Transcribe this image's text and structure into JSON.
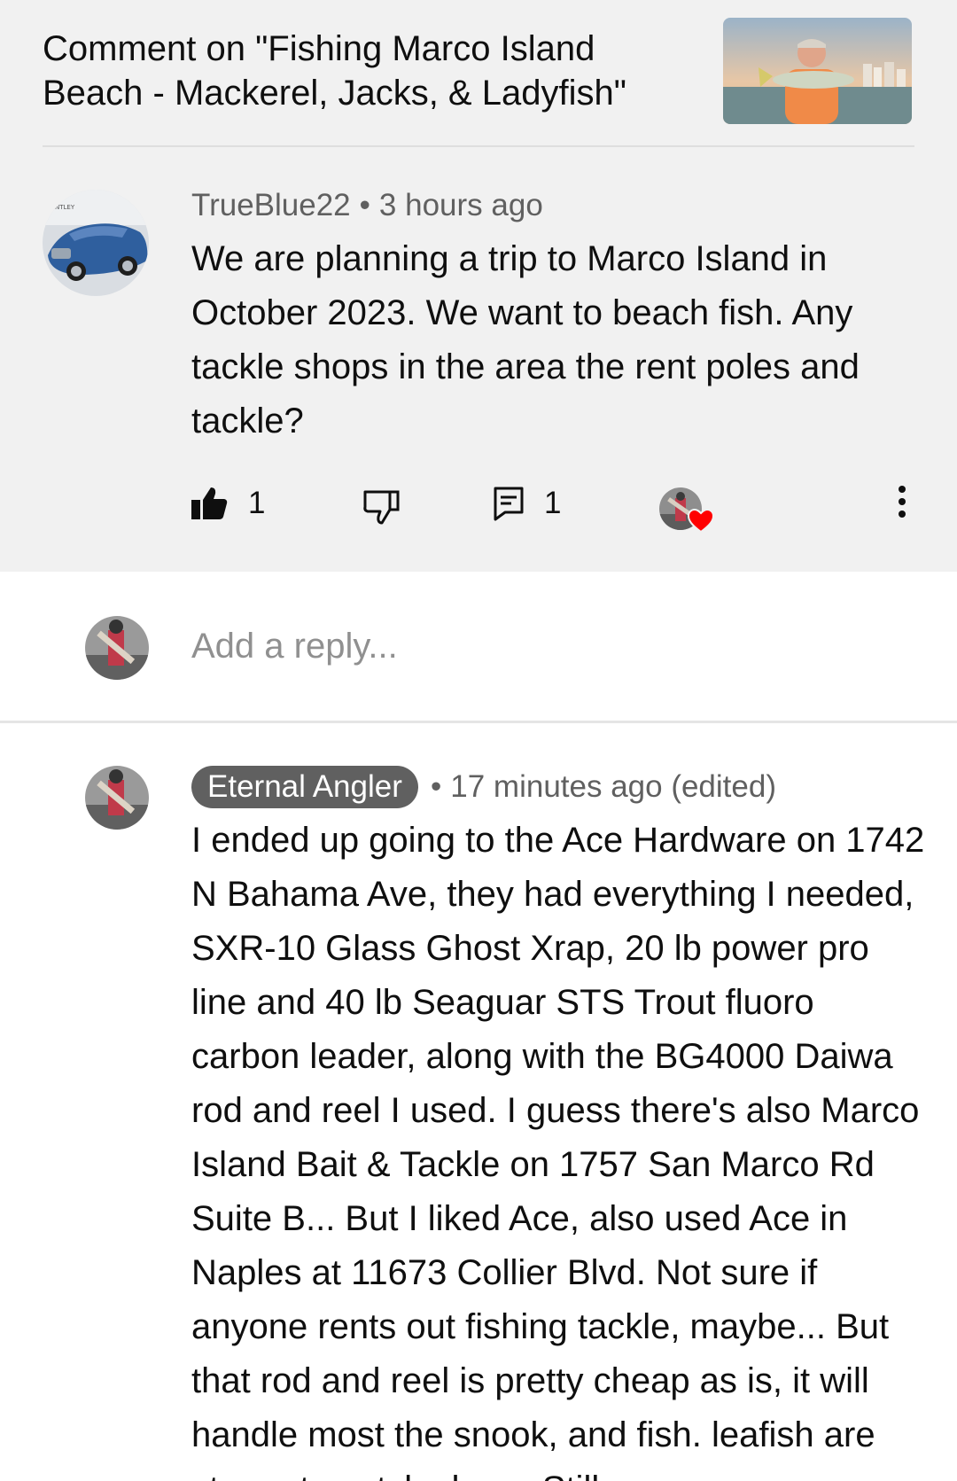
{
  "header": {
    "title": "Comment on \"Fishing Marco Island Beach - Mackerel, Jacks, & Ladyfish\""
  },
  "comment": {
    "author": "TrueBlue22",
    "separator": "•",
    "time": "3 hours ago",
    "text": "We are planning a trip to Marco Island in October 2023.  We want to beach fish.  Any tackle shops in the area the rent poles and tackle?",
    "like_count": "1",
    "reply_count": "1"
  },
  "reply_box": {
    "placeholder": "Add a reply..."
  },
  "reply": {
    "author": "Eternal Angler",
    "separator": "•",
    "time": "17 minutes ago (edited)",
    "text": "I ended up going to the Ace Hardware on 1742 N Bahama Ave, they had everything I needed, SXR-10 Glass Ghost Xrap, 20 lb power pro line and 40 lb Seaguar STS Trout fluoro carbon leader, along with the BG4000 Daiwa rod and reel I used. I guess there's also Marco Island Bait & Tackle on 1757 San Marco Rd Suite B... But I liked Ace, also used Ace in Naples at 11673 Collier Blvd. Not sure if anyone rents out fishing tackle, maybe...  But that rod and reel is pretty cheap as is, it will handle most the snook, and fish. leafish are strong to catch shore. Still"
  },
  "icons": {
    "like": "thumbs-up-filled-icon",
    "dislike": "thumbs-down-outline-icon",
    "reply": "comment-icon",
    "creator_heart": "heart-icon",
    "more": "more-vertical-icon"
  },
  "colors": {
    "grey_bg": "#f1f1f1",
    "secondary_text": "#606060",
    "heart": "#ff0000",
    "author_chip": "#606060"
  }
}
